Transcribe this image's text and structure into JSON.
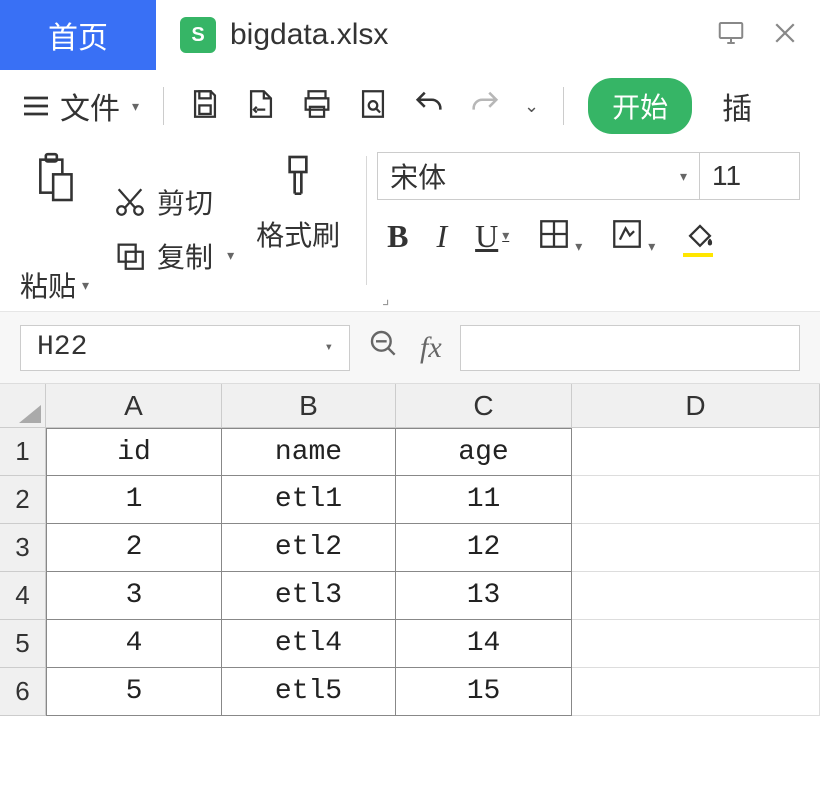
{
  "titlebar": {
    "home_tab": "首页",
    "filename": "bigdata.xlsx"
  },
  "menubar": {
    "file_label": "文件",
    "start_label": "开始",
    "insert_label": "插"
  },
  "ribbon": {
    "paste_label": "粘贴",
    "cut_label": "剪切",
    "copy_label": "复制",
    "format_brush_label": "格式刷",
    "font_name": "宋体",
    "font_size": "11"
  },
  "formulabar": {
    "cell_ref": "H22",
    "fx_label": "fx"
  },
  "sheet": {
    "columns": [
      "A",
      "B",
      "C",
      "D"
    ],
    "rows": [
      "1",
      "2",
      "3",
      "4",
      "5",
      "6"
    ],
    "data": [
      [
        "id",
        "name",
        "age",
        ""
      ],
      [
        "1",
        "etl1",
        "11",
        ""
      ],
      [
        "2",
        "etl2",
        "12",
        ""
      ],
      [
        "3",
        "etl3",
        "13",
        ""
      ],
      [
        "4",
        "etl4",
        "14",
        ""
      ],
      [
        "5",
        "etl5",
        "15",
        ""
      ]
    ]
  }
}
